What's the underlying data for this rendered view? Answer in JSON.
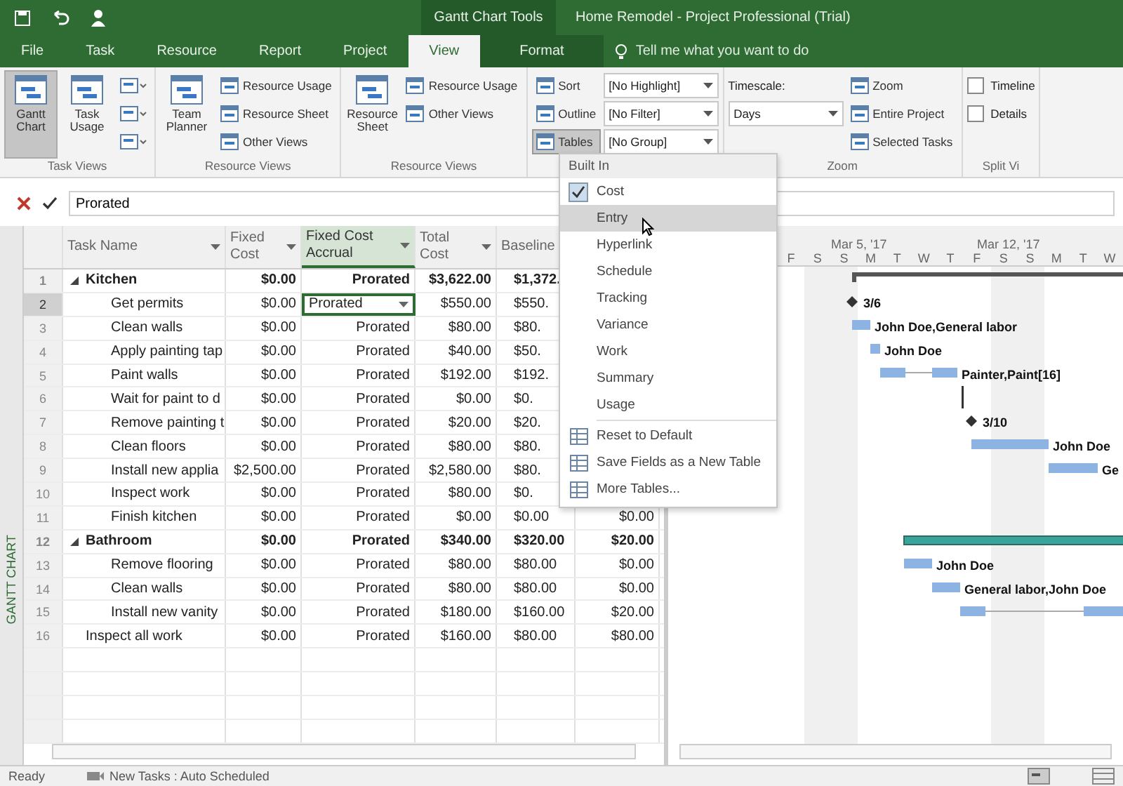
{
  "title_bar": {
    "context_title": "Gantt Chart Tools",
    "title": "Home Remodel - Project Professional (Trial)"
  },
  "tabs": [
    {
      "label": "File",
      "selected": false
    },
    {
      "label": "Task",
      "selected": false
    },
    {
      "label": "Resource",
      "selected": false
    },
    {
      "label": "Report",
      "selected": false
    },
    {
      "label": "Project",
      "selected": false
    },
    {
      "label": "View",
      "selected": true
    },
    {
      "label": "Format",
      "selected": false
    }
  ],
  "tell_me": {
    "placeholder": "Tell me what you want to do"
  },
  "ribbon_groups": [
    {
      "label": "Task Views",
      "large": [
        {
          "label": "Gantt Chart",
          "selected": true
        },
        {
          "label": "Task Usage",
          "selected": false
        }
      ],
      "columns": [
        [
          {
            "kind": "icon"
          },
          {
            "kind": "icon"
          },
          {
            "kind": "icon"
          }
        ]
      ]
    },
    {
      "label": "Resource Views",
      "large": [
        {
          "label": "Team Planner",
          "selected": false
        }
      ],
      "columns": [
        [
          {
            "kind": "small",
            "label": "Resource Usage",
            "pressed": false
          },
          {
            "kind": "small",
            "label": "Resource Sheet",
            "pressed": false
          },
          {
            "kind": "small",
            "label": "Other Views",
            "pressed": false
          }
        ]
      ]
    },
    {
      "label": "Resource Views",
      "large": [
        {
          "label": "Resource Sheet",
          "selected": false
        }
      ],
      "columns": [
        [
          {
            "kind": "small",
            "label": "Resource Usage",
            "pressed": false
          },
          {
            "kind": "small",
            "label": "Other Views",
            "pressed": false
          }
        ]
      ]
    },
    {
      "columns": [
        [
          {
            "kind": "small",
            "label": "Sort",
            "pressed": false
          },
          {
            "kind": "small",
            "label": "Outline",
            "pressed": false
          },
          {
            "kind": "small",
            "label": "Tables",
            "pressed": true
          }
        ],
        [
          {
            "kind": "dropdown",
            "value": "[No Highlight]"
          },
          {
            "kind": "dropdown",
            "value": "[No Filter]"
          },
          {
            "kind": "dropdown",
            "value": "[No Group]"
          }
        ]
      ]
    },
    {
      "label": "Zoom",
      "columns": [
        [
          {
            "kind": "caption",
            "label": "Timescale:"
          },
          {
            "kind": "dropdown",
            "value": "Days"
          }
        ],
        [
          {
            "kind": "small",
            "label": "Zoom",
            "pressed": false
          },
          {
            "kind": "small",
            "label": "Entire Project",
            "pressed": false
          },
          {
            "kind": "small",
            "label": "Selected Tasks",
            "pressed": false
          }
        ]
      ]
    },
    {
      "label": "Split Vi",
      "columns": [
        [
          {
            "kind": "checkbox",
            "label": "Timeline",
            "checked": false
          },
          {
            "kind": "checkbox",
            "label": "Details",
            "checked": false
          }
        ]
      ]
    }
  ],
  "entry_bar": {
    "value": "Prorated"
  },
  "table": {
    "columns": [
      {
        "label": "Task Name",
        "highlighted": false
      },
      {
        "label": "Fixed Cost",
        "highlighted": false
      },
      {
        "label": "Fixed Cost Accrual",
        "highlighted": true
      },
      {
        "label": "Total Cost",
        "highlighted": false
      },
      {
        "label": "Baseline",
        "highlighted": false
      }
    ],
    "rows": [
      {
        "id": "1",
        "name": "Kitchen",
        "kind": "summary",
        "expanded": true,
        "selected": false,
        "fixed_cost": "$0.00",
        "accrual": "Prorated",
        "total_cost": "$3,622.00",
        "baseline": "$1,372.",
        "children": [
          {
            "id": "2",
            "name": "Get permits",
            "kind": "task",
            "selected": true,
            "fixed_cost": "$0.00",
            "accrual": "Prorated",
            "total_cost": "$550.00",
            "baseline": "$550.",
            "gantt_label": "3/6"
          },
          {
            "id": "3",
            "name": "Clean walls",
            "kind": "task",
            "selected": false,
            "fixed_cost": "$0.00",
            "accrual": "Prorated",
            "total_cost": "$80.00",
            "baseline": "$80.",
            "gantt_label": "John Doe,General labor"
          },
          {
            "id": "4",
            "name": "Apply painting tap",
            "kind": "task",
            "selected": false,
            "fixed_cost": "$0.00",
            "accrual": "Prorated",
            "total_cost": "$40.00",
            "baseline": "$50.",
            "gantt_label": "John Doe"
          },
          {
            "id": "5",
            "name": "Paint walls",
            "kind": "task",
            "selected": false,
            "fixed_cost": "$0.00",
            "accrual": "Prorated",
            "total_cost": "$192.00",
            "baseline": "$192.",
            "gantt_label": "Painter,Paint[16]"
          },
          {
            "id": "6",
            "name": "Wait for paint to d",
            "kind": "task",
            "selected": false,
            "fixed_cost": "$0.00",
            "accrual": "Prorated",
            "total_cost": "$0.00",
            "baseline": "$0."
          },
          {
            "id": "7",
            "name": "Remove painting t",
            "kind": "task",
            "selected": false,
            "fixed_cost": "$0.00",
            "accrual": "Prorated",
            "total_cost": "$20.00",
            "baseline": "$20.",
            "gantt_label": "3/10"
          },
          {
            "id": "8",
            "name": "Clean floors",
            "kind": "task",
            "selected": false,
            "fixed_cost": "$0.00",
            "accrual": "Prorated",
            "total_cost": "$80.00",
            "baseline": "$80.",
            "gantt_label": "John Doe"
          },
          {
            "id": "9",
            "name": "Install new applia",
            "kind": "task",
            "selected": false,
            "fixed_cost": "$2,500.00",
            "accrual": "Prorated",
            "total_cost": "$2,580.00",
            "baseline": "$80.",
            "gantt_label": "Ge"
          },
          {
            "id": "10",
            "name": "Inspect work",
            "kind": "task",
            "selected": false,
            "fixed_cost": "$0.00",
            "accrual": "Prorated",
            "total_cost": "$80.00",
            "baseline": "$0."
          },
          {
            "id": "11",
            "name": "Finish kitchen",
            "kind": "task",
            "selected": false,
            "fixed_cost": "$0.00",
            "accrual": "Prorated",
            "total_cost": "$0.00",
            "baseline": "$0.00",
            "column_7": "$0.00"
          }
        ]
      },
      {
        "id": "12",
        "name": "Bathroom",
        "kind": "summary",
        "expanded": true,
        "selected": false,
        "fixed_cost": "$0.00",
        "accrual": "Prorated",
        "total_cost": "$340.00",
        "baseline": "$320.00",
        "column_7": "$20.00",
        "children": [
          {
            "id": "13",
            "name": "Remove flooring",
            "kind": "task",
            "selected": false,
            "fixed_cost": "$0.00",
            "accrual": "Prorated",
            "total_cost": "$80.00",
            "baseline": "$80.00",
            "column_7": "$0.00",
            "gantt_label": "John Doe"
          },
          {
            "id": "14",
            "name": "Clean walls",
            "kind": "task",
            "selected": false,
            "fixed_cost": "$0.00",
            "accrual": "Prorated",
            "total_cost": "$80.00",
            "baseline": "$80.00",
            "column_7": "$0.00",
            "gantt_label": "General labor,John Doe"
          },
          {
            "id": "15",
            "name": "Install new vanity",
            "kind": "task",
            "selected": false,
            "fixed_cost": "$0.00",
            "accrual": "Prorated",
            "total_cost": "$180.00",
            "baseline": "$160.00",
            "column_7": "$20.00"
          }
        ]
      },
      {
        "id": "16",
        "name": "Inspect all work",
        "kind": "task",
        "selected": false,
        "fixed_cost": "$0.00",
        "accrual": "Prorated",
        "total_cost": "$160.00",
        "baseline": "$80.00",
        "column_7": "$80.00"
      }
    ]
  },
  "timescale": {
    "weeks": [
      "Mar 5, '17",
      "Mar 12, '17"
    ],
    "days": [
      "F",
      "S",
      "S",
      "M",
      "T",
      "W",
      "T",
      "F",
      "S",
      "S",
      "M",
      "T",
      "W"
    ]
  },
  "side_label": "GANTT CHART",
  "tables_menu": {
    "heading": "Built In",
    "items": [
      {
        "label": "Cost",
        "checked": true,
        "selected": false
      },
      {
        "label": "Entry",
        "checked": false,
        "selected": true
      },
      {
        "label": "Hyperlink",
        "checked": false,
        "selected": false
      },
      {
        "label": "Schedule",
        "checked": false,
        "selected": false
      },
      {
        "label": "Tracking",
        "checked": false,
        "selected": false
      },
      {
        "label": "Variance",
        "checked": false,
        "selected": false
      },
      {
        "label": "Work",
        "checked": false,
        "selected": false
      },
      {
        "label": "Summary",
        "checked": false,
        "selected": false
      },
      {
        "label": "Usage",
        "checked": false,
        "selected": false
      }
    ],
    "actions": [
      "Reset to Default",
      "Save Fields as a New Table",
      "More Tables..."
    ]
  },
  "status_bar": {
    "state": "Ready",
    "scheduling": "New Tasks : Auto Scheduled"
  }
}
